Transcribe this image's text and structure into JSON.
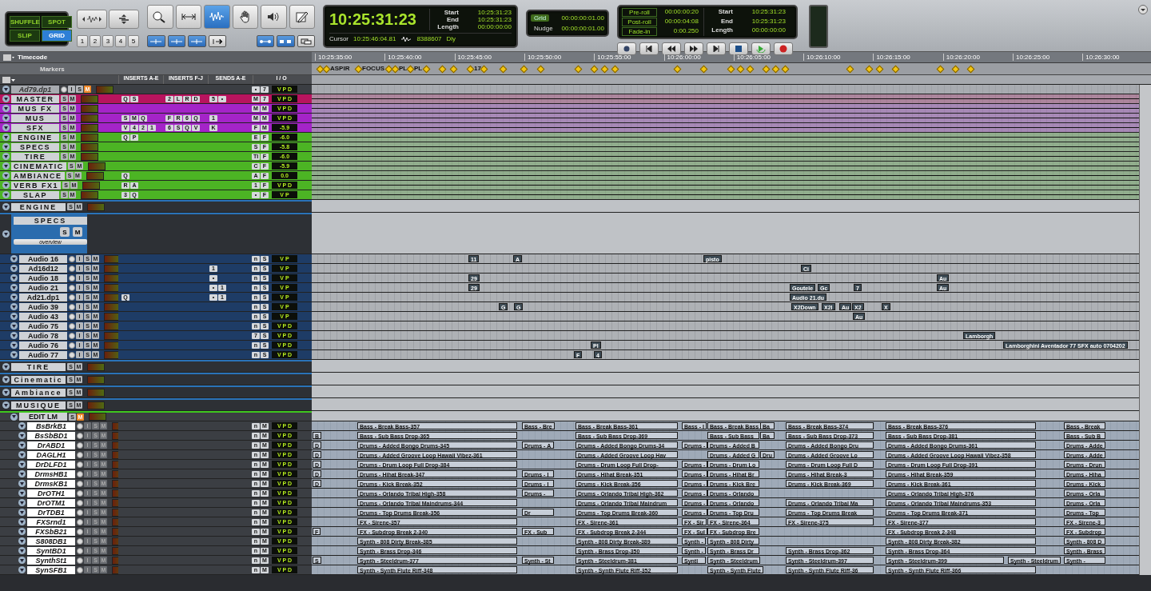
{
  "toolbar": {
    "edit_modes": [
      {
        "label": "SHUFFLE",
        "selected": false
      },
      {
        "label": "SPOT",
        "selected": false
      },
      {
        "label": "SLIP",
        "selected": false
      },
      {
        "label": "GRID",
        "selected": true
      }
    ],
    "zoom_presets": [
      "1",
      "2",
      "3",
      "4",
      "5"
    ],
    "tools": [
      {
        "kind": "trim",
        "selected": false
      },
      {
        "kind": "selector",
        "selected": true
      },
      {
        "kind": "grabber",
        "selected": false
      },
      {
        "kind": "speaker",
        "selected": false
      },
      {
        "kind": "pencil",
        "selected": false
      }
    ],
    "counter": {
      "main": "10:25:31:23",
      "rows": [
        {
          "label": "Start",
          "value": "10:25:31:23"
        },
        {
          "label": "End",
          "value": "10:25:31:23"
        },
        {
          "label": "Length",
          "value": "00:00:00:00"
        }
      ],
      "cursor_label": "Cursor",
      "cursor": "10:25:46:04.81",
      "sample": "8388607",
      "delay": "Dly"
    },
    "grid": {
      "label": "Grid",
      "value": "00:00:00:01.00"
    },
    "nudge": {
      "label": "Nudge",
      "value": "00:00:00:01.00"
    },
    "transport": {
      "rolls": [
        {
          "label": "Pre-roll",
          "value": "00:00:00:20"
        },
        {
          "label": "Post-roll",
          "value": "00:00:04:08"
        },
        {
          "label": "Fade-in",
          "value": "0:00.250"
        }
      ],
      "rows": [
        {
          "label": "Start",
          "value": "10:25:31:23"
        },
        {
          "label": "End",
          "value": "10:25:31:23"
        },
        {
          "label": "Length",
          "value": "00:00:00:00"
        }
      ]
    }
  },
  "ruler": {
    "timecode_label": "Timecode",
    "ticks": [
      "10:25:35:00",
      "10:25:40:00",
      "10:25:45:00",
      "10:25:50:00",
      "10:25:55:00",
      "10:26:00:00",
      "10:26:05:00",
      "10:26:10:00",
      "10:26:15:00",
      "10:26:20:00",
      "10:26:25:00",
      "10:26:30:00"
    ],
    "markers_label": "Markers",
    "markers": [
      "ASPIR",
      "FOCUS",
      "PL",
      "PL",
      "17"
    ]
  },
  "columns": [
    "INSERTS A-E",
    "INSERTS F-J",
    "SENDS A-E",
    "I / O"
  ],
  "tracks": [
    {
      "name": "Ad79.dp1",
      "kind": "dimmed",
      "muted": true,
      "controls": "I S M",
      "io": "• 7",
      "output": "V P D"
    },
    {
      "name": "MASTER",
      "kind": "aux",
      "color": "#b8145e",
      "muted": false,
      "controls": "S M",
      "inserts_a": "Q S",
      "inserts_f": "2 L R D",
      "sends": "5 •",
      "io": "M 7",
      "output": "V P D"
    },
    {
      "name": "MUS FX",
      "kind": "aux",
      "color": "#a424c8",
      "muted": false,
      "controls": "S M",
      "io": "M M",
      "output": "V P D"
    },
    {
      "name": "MUS",
      "kind": "aux",
      "color": "#a424c8",
      "muted": false,
      "controls": "S M",
      "inserts_a": "S M Q",
      "inserts_f": "F R 6 Q",
      "sends": "1",
      "io": "M M",
      "output": "V P D"
    },
    {
      "name": "SFX",
      "kind": "aux",
      "color": "#a424c8",
      "muted": false,
      "controls": "S M",
      "inserts_a": "V 4 2 1",
      "inserts_f": "6 S Q V",
      "sends": "K",
      "io": "F M",
      "output": "-5.9"
    },
    {
      "name": "ENGINE",
      "kind": "aux",
      "color": "#4cb424",
      "muted": false,
      "controls": "S M",
      "inserts_a": "Q P",
      "io": "E F",
      "output": "-6.0"
    },
    {
      "name": "SPECS",
      "kind": "aux",
      "color": "#4cb424",
      "muted": false,
      "controls": "S M",
      "io": "S F",
      "output": "-5.8"
    },
    {
      "name": "TIRE",
      "kind": "aux",
      "color": "#4cb424",
      "muted": false,
      "controls": "S M",
      "io": "TI F",
      "output": "-6.0"
    },
    {
      "name": "CINEMATIC",
      "kind": "aux",
      "color": "#4cb424",
      "muted": false,
      "controls": "S M",
      "io": "C F",
      "output": "-5.9"
    },
    {
      "name": "AMBIANCE",
      "kind": "aux",
      "color": "#4cb424",
      "muted": false,
      "controls": "S M",
      "inserts_a": "Q",
      "io": "A F",
      "output": "0.0"
    },
    {
      "name": "VERB FX1",
      "kind": "aux",
      "color": "#4cb424",
      "muted": false,
      "controls": "S M",
      "inserts_a": "R A",
      "io": "1 F",
      "output": "V P D"
    },
    {
      "name": "SLAP",
      "kind": "aux",
      "color": "#4cb424",
      "muted": false,
      "controls": "S M",
      "inserts_a": "3 Q",
      "io": "• F",
      "output": "V P"
    },
    {
      "name": "ENGINE",
      "kind": "folder",
      "muted": false,
      "controls": "S M"
    },
    {
      "name": "SPECS",
      "kind": "big-folder",
      "muted": false,
      "controls": "S M",
      "button": "overview",
      "children": [
        {
          "name": "Audio 16",
          "kind": "audio",
          "muted": false,
          "controls": "I S M",
          "io": "n S",
          "output": "V P",
          "clips": [
            "11",
            "A",
            "pisto"
          ]
        },
        {
          "name": "Ad16d12",
          "kind": "audio",
          "muted": false,
          "controls": "I S M",
          "sends": "1",
          "io": "n S",
          "output": "V P",
          "clips": [
            "Ci"
          ]
        },
        {
          "name": "Audio 18",
          "kind": "audio",
          "muted": false,
          "controls": "I S M",
          "sends": "•",
          "io": "n S",
          "output": "V P",
          "clips": [
            "29",
            "Au"
          ]
        },
        {
          "name": "Audio 21",
          "kind": "audio",
          "muted": false,
          "controls": "I S M",
          "sends": "• 1",
          "io": "n S",
          "output": "V P",
          "clips": [
            "29",
            "Goutele",
            "Gc",
            "7",
            "Au"
          ]
        },
        {
          "name": "Ad21.dp1",
          "kind": "audio",
          "muted": false,
          "controls": "I S M",
          "inserts_a": "Q",
          "sends": "• 1",
          "io": "n S",
          "output": "V P",
          "clips": [
            "Audio 21.du"
          ]
        },
        {
          "name": "Audio 39",
          "kind": "audio",
          "muted": false,
          "controls": "I S M",
          "io": "n S",
          "output": "V P",
          "clips": [
            "G",
            "G",
            "X2Down",
            "X2I",
            "Au",
            "X2",
            "X"
          ]
        },
        {
          "name": "Audio 43",
          "kind": "audio",
          "muted": false,
          "controls": "I S M",
          "io": "n S",
          "output": "V P",
          "clips": [
            "Au"
          ]
        },
        {
          "name": "Audio 75",
          "kind": "audio",
          "muted": false,
          "controls": "I S M",
          "io": "n S",
          "output": "V P D"
        },
        {
          "name": "Audio 78",
          "kind": "audio",
          "muted": false,
          "controls": "I S M",
          "io": "7 S",
          "output": "V P D",
          "clips": [
            "Lamborgh"
          ]
        },
        {
          "name": "Audio 76",
          "kind": "audio",
          "muted": false,
          "controls": "I S M",
          "io": "n S",
          "output": "V P D",
          "clips": [
            "Pl",
            "Lamborghini Aventador 77 SFX auto 0704202"
          ]
        },
        {
          "name": "Audio 77",
          "kind": "audio",
          "muted": false,
          "controls": "I S M",
          "io": "n S",
          "output": "V P D",
          "clips": [
            "F",
            "4"
          ]
        }
      ]
    },
    {
      "name": "TIRE",
      "kind": "folder",
      "muted": false,
      "controls": "S M"
    },
    {
      "name": "Cinematic",
      "kind": "folder",
      "muted": false,
      "controls": "S M"
    },
    {
      "name": "Ambiance",
      "kind": "folder",
      "muted": false,
      "controls": "S M"
    },
    {
      "name": "MUSIQUE",
      "kind": "folder",
      "muted": false,
      "controls": "S M",
      "children": [
        {
          "name": "EDIT LM",
          "kind": "sub-folder",
          "muted": true,
          "controls": "S M",
          "children": [
            {
              "name": "BsBrkB1",
              "kind": "instrument",
              "muted": false,
              "controls": "I S M",
              "io": "n M",
              "output": "V P D",
              "clips": [
                "Bass - Break Bass-357",
                "Bass - Bre",
                "Bass - Break Bass-361",
                "Bass - I",
                "Bass - Break Bass",
                "Ba",
                "Bass - Break Bass-374",
                "Bass - Break Bass-376",
                "Bass - Break"
              ]
            },
            {
              "name": "BsSbBD1",
              "kind": "instrument",
              "muted": false,
              "controls": "I S M",
              "io": "n M",
              "output": "V P D",
              "clips": [
                "B",
                "Bass - Sub Bass Drop-365",
                "Bass - Sub Bass Drop-369",
                "Bass - Sub Bass",
                "Ba",
                "Bass - Sub Bass Drop-373",
                "Bass - Sub Bass Drop-381",
                "Bass - Sub B"
              ]
            },
            {
              "name": "DrABD1",
              "kind": "instrument",
              "muted": false,
              "controls": "I S M",
              "io": "n M",
              "output": "V P D",
              "clips": [
                "D",
                "Drums - Added Bongo Drums-345",
                "Drums - A",
                "Drums - Added Bongo Drums-34",
                "Drums -",
                "Drums - Added B",
                "Drums - Added Bongo Dru",
                "Drums - Added Bongo Drums-361",
                "Drums - Adde"
              ]
            },
            {
              "name": "DAGLH1",
              "kind": "instrument",
              "muted": false,
              "controls": "I S M",
              "io": "n M",
              "output": "V P D",
              "clips": [
                "D",
                "Drums - Added Groove Loop Hawaii Vibez-361",
                "Drums - Added Groove Loop Hav",
                "Drums - Added G",
                "Dru",
                "Drums - Added Groove Lo",
                "Drums - Added Groove Loop Hawaii Vibez-358",
                "Drums - Adde"
              ]
            },
            {
              "name": "DrDLFD1",
              "kind": "instrument",
              "muted": false,
              "controls": "I S M",
              "io": "n M",
              "output": "V P D",
              "clips": [
                "D",
                "Drums - Drum Loop Full Drop-384",
                "Drums - Drum Loop Full Drop-",
                "Drums -",
                "Drums - Drum Lo",
                "Drums - Drum Loop Full D",
                "Drums - Drum Loop Full Drop-391",
                "Drums - Drun"
              ]
            },
            {
              "name": "DrmsHB1",
              "kind": "instrument",
              "muted": false,
              "controls": "I S M",
              "io": "n M",
              "output": "V P D",
              "clips": [
                "D",
                "Drums - Hihat Break-347",
                "Drums - I",
                "Drums - Hihat Break-351",
                "Drums -",
                "Drums - Hihat Br",
                "Drums - Hihat Break-3",
                "Drums - Hihat Break-359",
                "Drums - Hiha"
              ]
            },
            {
              "name": "DrmsKB1",
              "kind": "instrument",
              "muted": false,
              "controls": "I S M",
              "io": "n M",
              "output": "V P D",
              "clips": [
                "D",
                "Drums - Kick Break-352",
                "Drums - I",
                "Drums - Kick Break-356",
                "Drums -",
                "Drums - Kick Bre",
                "Drums - Kick Break-369",
                "Drums - Kick Break-361",
                "Drums - Kick"
              ]
            },
            {
              "name": "DrOTH1",
              "kind": "instrument",
              "muted": false,
              "controls": "I S M",
              "io": "n M",
              "output": "V P D",
              "clips": [
                "Drums - Orlando Tribal High-358",
                "Drums -",
                "Drums - Orlando Tribal High-362",
                "Drums -",
                "Drums - Orlando",
                "Drums - Orlando Tribal High-376",
                "Drums - Orla"
              ]
            },
            {
              "name": "DrOTM1",
              "kind": "instrument",
              "muted": false,
              "controls": "I S M",
              "io": "n M",
              "output": "V P D",
              "clips": [
                "Drums - Orlando Tribal Maindrums-344",
                "Drums - Orlando Tribal Maindrum",
                "Drums -",
                "Drums - Orlando",
                "Drums - Orlando Tribal Ma",
                "Drums - Orlando Tribal Maindrums-353",
                "Drums - Orla"
              ]
            },
            {
              "name": "DrTDB1",
              "kind": "instrument",
              "muted": false,
              "controls": "I S M",
              "io": "n M",
              "output": "V P D",
              "clips": [
                "Drums - Top Drums Break-356",
                "Dr",
                "Drums - Top Drums Break-360",
                "Drums -",
                "Drums - Top Dru",
                "Drums - Top Drums Break",
                "Drums - Top Drums Break-371",
                "Drums - Top"
              ]
            },
            {
              "name": "FXSrnd1",
              "kind": "instrument",
              "muted": false,
              "controls": "I S M",
              "io": "n M",
              "output": "V P D",
              "clips": [
                "FX - Sirene-357",
                "FX - Sirene-361",
                "FX - Sir",
                "FX - Sirene-364",
                "FX - Sirene-375",
                "FX - Sirene-377",
                "FX - Sirene-3"
              ]
            },
            {
              "name": "FXSbB21",
              "kind": "instrument",
              "muted": false,
              "controls": "I S M",
              "io": "n M",
              "output": "V P D",
              "clips": [
                "F",
                "FX - Subdrop Break 2-340",
                "FX - Sub",
                "FX - Subdrop Break 2-344",
                "FX - Sul",
                "FX - Subdrop Bre",
                "FX - Subdrop Break 2-348",
                "FX - Subdrop"
              ]
            },
            {
              "name": "S808DB1",
              "kind": "instrument",
              "muted": false,
              "controls": "I S M",
              "io": "n M",
              "output": "V P D",
              "clips": [
                "Synth - 808 Dirty Break-385",
                "Synth - 808 Dirty Break-389",
                "Synth -",
                "Synth - 808 Dirty",
                "Synth - 808 Dirty Break-382",
                "Synth - 808 D"
              ]
            },
            {
              "name": "SyntBD1",
              "kind": "instrument",
              "muted": false,
              "controls": "I S M",
              "io": "n M",
              "output": "V P D",
              "clips": [
                "Synth - Brass Drop-346",
                "Synth - Brass Drop-350",
                "Synth -",
                "Synth - Brass Dr",
                "Synth - Brass Drop-362",
                "Synth - Brass Drop-364",
                "Synth - Brass"
              ]
            },
            {
              "name": "SynthSt1",
              "kind": "instrument",
              "muted": false,
              "controls": "I S M",
              "io": "n M",
              "output": "V P D",
              "clips": [
                "S",
                "Synth - Steeldrum-377",
                "Synth - St",
                "Synth - Steeldrum-381",
                "Syntl",
                "Synth - Steeldrum",
                "Synth - Steeldrum-397",
                "Synth - Steeldrum-399",
                "Synth - Steeldrum",
                "Synth -"
              ]
            },
            {
              "name": "SynSFB1",
              "kind": "instrument",
              "muted": false,
              "controls": "I S M",
              "io": "n M",
              "output": "V P D",
              "clips": [
                "Synth - Synth Flute Riff-348",
                "Synth - Synth Flute Riff-352",
                "Synth - Synth Flute",
                "Synth - Synth Flute Riff-36",
                "Synth - Synth Flute Riff-366"
              ]
            }
          ]
        }
      ]
    }
  ]
}
